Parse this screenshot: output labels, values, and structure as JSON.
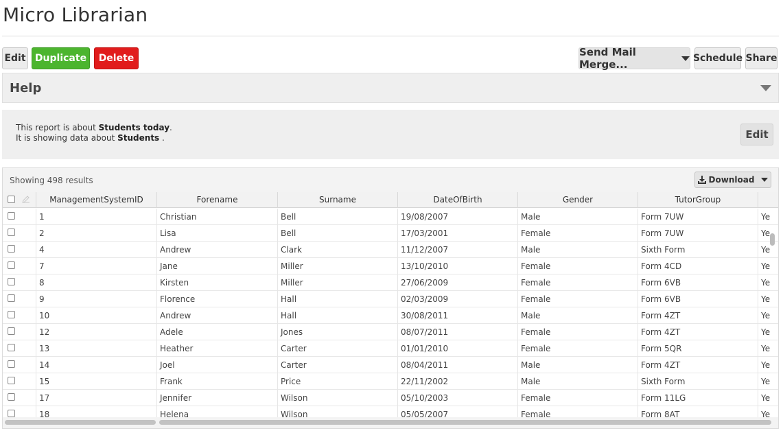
{
  "app": {
    "title": "Micro Librarian"
  },
  "toolbar": {
    "edit": "Edit",
    "duplicate": "Duplicate",
    "delete": "Delete",
    "send_mail_merge": "Send Mail Merge...",
    "schedule": "Schedule",
    "share": "Share"
  },
  "help": {
    "title": "Help",
    "icon": "chevron-down-icon"
  },
  "info": {
    "line1_prefix": "This report is about ",
    "line1_bold": "Students today",
    "line1_suffix": ".",
    "line2_prefix": "It is showing data about ",
    "line2_bold": "Students",
    "line2_suffix": " .",
    "edit": "Edit"
  },
  "results": {
    "showing": "Showing 498 results",
    "download": "Download",
    "columns": [
      "ManagementSystemID",
      "Forename",
      "Surname",
      "DateOfBirth",
      "Gender",
      "TutorGroup"
    ],
    "rows": [
      [
        "1",
        "Christian",
        "Bell",
        "19/08/2007",
        "Male",
        "Form 7UW",
        "Ye"
      ],
      [
        "2",
        "Lisa",
        "Bell",
        "17/03/2001",
        "Female",
        "Form 7UW",
        "Ye"
      ],
      [
        "4",
        "Andrew",
        "Clark",
        "11/12/2007",
        "Male",
        "Sixth Form",
        "Ye"
      ],
      [
        "7",
        "Jane",
        "Miller",
        "13/10/2010",
        "Female",
        "Form 4CD",
        "Ye"
      ],
      [
        "8",
        "Kirsten",
        "Miller",
        "27/06/2009",
        "Female",
        "Form 6VB",
        "Ye"
      ],
      [
        "9",
        "Florence",
        "Hall",
        "02/03/2009",
        "Female",
        "Form 6VB",
        "Ye"
      ],
      [
        "10",
        "Andrew",
        "Hall",
        "30/08/2011",
        "Male",
        "Form 4ZT",
        "Ye"
      ],
      [
        "12",
        "Adele",
        "Jones",
        "08/07/2011",
        "Female",
        "Form 4ZT",
        "Ye"
      ],
      [
        "13",
        "Heather",
        "Carter",
        "01/01/2010",
        "Female",
        "Form 5QR",
        "Ye"
      ],
      [
        "14",
        "Joel",
        "Carter",
        "08/04/2011",
        "Male",
        "Form 4ZT",
        "Ye"
      ],
      [
        "15",
        "Frank",
        "Price",
        "22/11/2002",
        "Male",
        "Sixth Form",
        "Ye"
      ],
      [
        "17",
        "Jennifer",
        "Wilson",
        "05/10/2003",
        "Female",
        "Form 11LG",
        "Ye"
      ],
      [
        "18",
        "Helena",
        "Wilson",
        "05/05/2007",
        "Female",
        "Form 8AT",
        "Ye"
      ]
    ]
  }
}
